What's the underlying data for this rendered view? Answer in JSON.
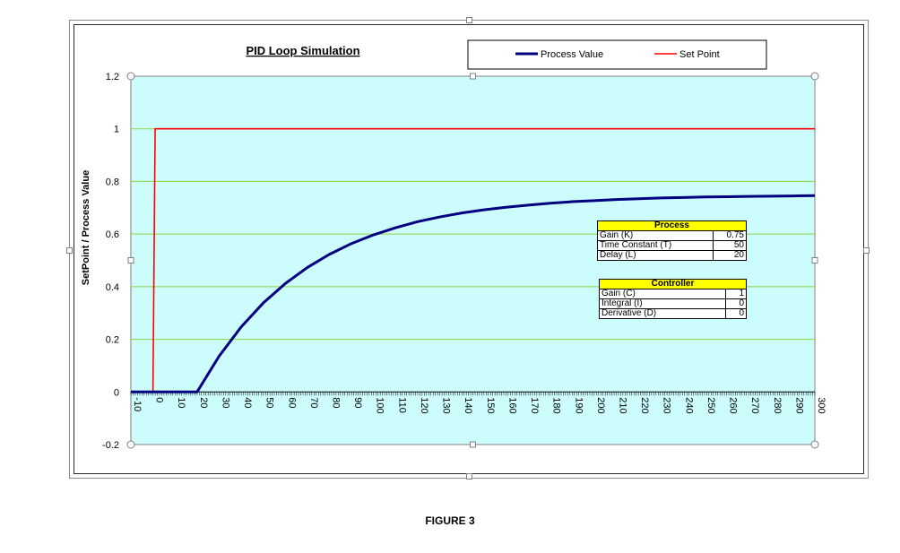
{
  "figure_caption": "FIGURE 3",
  "colors": {
    "plot_background": "#ccfcfc",
    "gridline": "#8ed642",
    "process_value": "#000080",
    "set_point": "#ff0000",
    "table_header": "#ffff00"
  },
  "process_table": {
    "title": "Process",
    "rows": [
      {
        "label": "Gain (K)",
        "value": "0.75"
      },
      {
        "label": "Time Constant (T)",
        "value": "50"
      },
      {
        "label": "Delay (L)",
        "value": "20"
      }
    ]
  },
  "controller_table": {
    "title": "Controller",
    "rows": [
      {
        "label": "Gain (C)",
        "value": "1"
      },
      {
        "label": "Integral (I)",
        "value": "0"
      },
      {
        "label": "Derivative (D)",
        "value": "0"
      }
    ]
  },
  "chart_data": {
    "type": "line",
    "title": "PID Loop Simulation",
    "xlabel": "",
    "ylabel": "SetPoint / Process Value",
    "xlim": [
      -10,
      300
    ],
    "ylim": [
      -0.2,
      1.2
    ],
    "x_ticks": [
      -10,
      0,
      10,
      20,
      30,
      40,
      50,
      60,
      70,
      80,
      90,
      100,
      110,
      120,
      130,
      140,
      150,
      160,
      170,
      180,
      190,
      200,
      210,
      220,
      230,
      240,
      250,
      260,
      270,
      280,
      290,
      300
    ],
    "x_tick_labels": [
      "-10",
      "0",
      "10",
      "20",
      "30",
      "40",
      "50",
      "60",
      "70",
      "80",
      "90",
      "100",
      "110",
      "120",
      "130",
      "140",
      "150",
      "160",
      "170",
      "180",
      "190",
      "200",
      "210",
      "220",
      "230",
      "240",
      "250",
      "260",
      "270",
      "280",
      "290",
      "300"
    ],
    "y_ticks": [
      -0.2,
      0,
      0.2,
      0.4,
      0.6,
      0.8,
      1,
      1.2
    ],
    "y_tick_labels": [
      "-0.2",
      "0",
      "0.2",
      "0.4",
      "0.6",
      "0.8",
      "1",
      "1.2"
    ],
    "grid": "horizontal",
    "legend_position": "top-right",
    "series": [
      {
        "name": "Process Value",
        "color": "#000080",
        "x": [
          -10,
          0,
          10,
          20,
          30,
          40,
          50,
          60,
          70,
          80,
          90,
          100,
          110,
          120,
          130,
          140,
          150,
          160,
          170,
          180,
          190,
          200,
          210,
          220,
          230,
          240,
          250,
          260,
          270,
          280,
          290,
          300
        ],
        "y": [
          0,
          0,
          0,
          0,
          0.136,
          0.247,
          0.338,
          0.412,
          0.473,
          0.523,
          0.564,
          0.597,
          0.624,
          0.647,
          0.665,
          0.68,
          0.692,
          0.702,
          0.71,
          0.717,
          0.723,
          0.727,
          0.731,
          0.734,
          0.737,
          0.739,
          0.741,
          0.742,
          0.743,
          0.744,
          0.745,
          0.746
        ]
      },
      {
        "name": "Set Point",
        "color": "#ff0000",
        "x": [
          -10,
          0,
          0,
          1,
          300
        ],
        "y": [
          0,
          0,
          0,
          1,
          1
        ]
      }
    ]
  }
}
